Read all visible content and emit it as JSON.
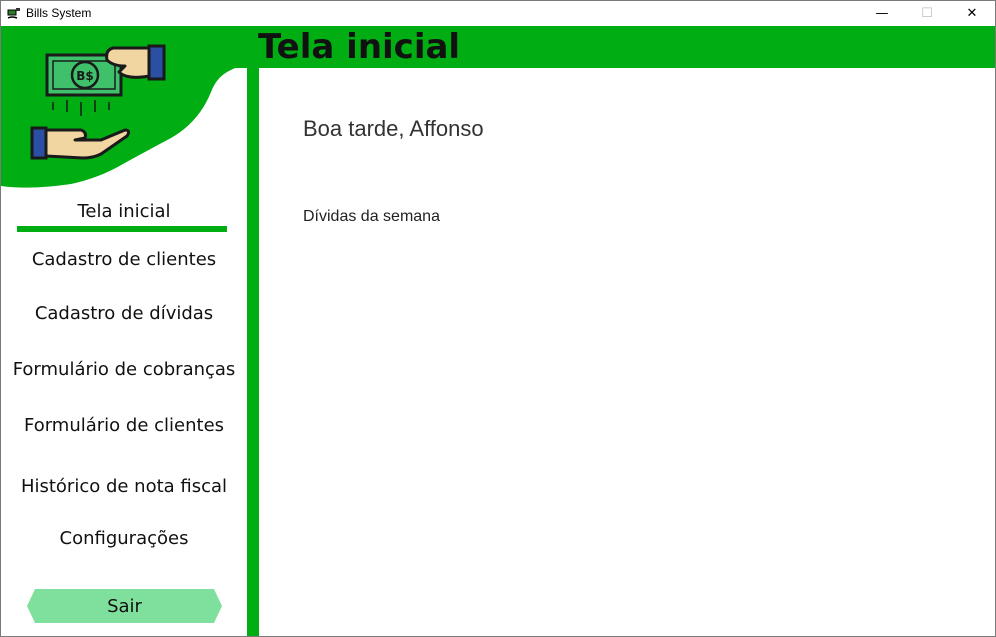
{
  "window": {
    "title": "Bills System",
    "minimize_glyph": "—",
    "maximize_glyph": "☐",
    "close_glyph": "✕"
  },
  "header": {
    "title": "Tela inicial"
  },
  "sidebar": {
    "logo": "hand-money-icon",
    "items": [
      {
        "label": "Tela inicial",
        "active": true
      },
      {
        "label": "Cadastro de clientes"
      },
      {
        "label": "Cadastro de dívidas"
      },
      {
        "label": "Formulário de cobranças"
      },
      {
        "label": "Formulário de clientes"
      },
      {
        "label": "Histórico de nota fiscal"
      },
      {
        "label": "Configurações"
      }
    ],
    "logout_label": "Sair"
  },
  "main": {
    "greeting": "Boa tarde, Affonso",
    "section_title": "Dívidas da semana"
  },
  "colors": {
    "brand_green": "#00ad12",
    "logout_green": "#7fe09d",
    "bill_green": "#3ec16a"
  }
}
